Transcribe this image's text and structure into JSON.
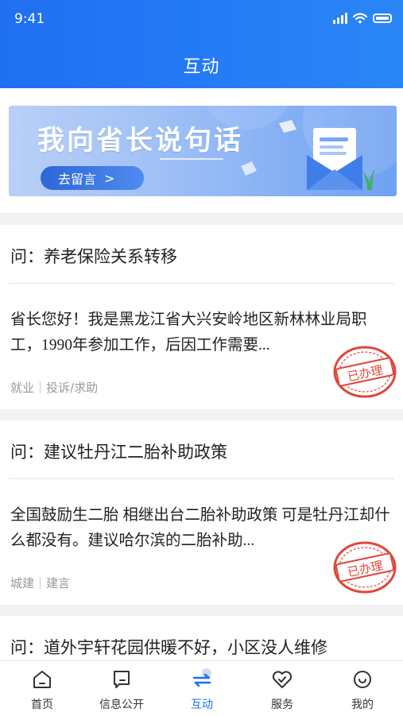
{
  "status_bar": {
    "time": "9:41"
  },
  "header": {
    "title": "互动"
  },
  "banner": {
    "title": "我向省长说句话",
    "button_label": "去留言",
    "button_chevron": ">"
  },
  "posts": [
    {
      "question": "问：养老保险关系转移",
      "body": "省长您好！我是黑龙江省大兴安岭地区新林林业局职工，1990年参加工作，后因工作需要...",
      "tags": [
        "就业",
        "投诉/求助"
      ],
      "stamp": "已办理"
    },
    {
      "question": "问：建议牡丹江二胎补助政策",
      "body": "全国鼓励生二胎 相继出台二胎补助政策 可是牡丹江却什么都没有。建议哈尔滨的二胎补助...",
      "tags": [
        "城建",
        "建言"
      ],
      "stamp": "已办理"
    },
    {
      "question": "问：道外宇轩花园供暖不好，小区没人维修"
    }
  ],
  "tabbar": {
    "items": [
      {
        "label": "首页",
        "icon": "home-icon"
      },
      {
        "label": "信息公开",
        "icon": "message-icon"
      },
      {
        "label": "互动",
        "icon": "interact-icon"
      },
      {
        "label": "服务",
        "icon": "heart-icon"
      },
      {
        "label": "我的",
        "icon": "profile-icon"
      }
    ],
    "active": "互动"
  },
  "colors": {
    "accent": "#1f6ff2",
    "stamp_red": "#e0463a"
  }
}
